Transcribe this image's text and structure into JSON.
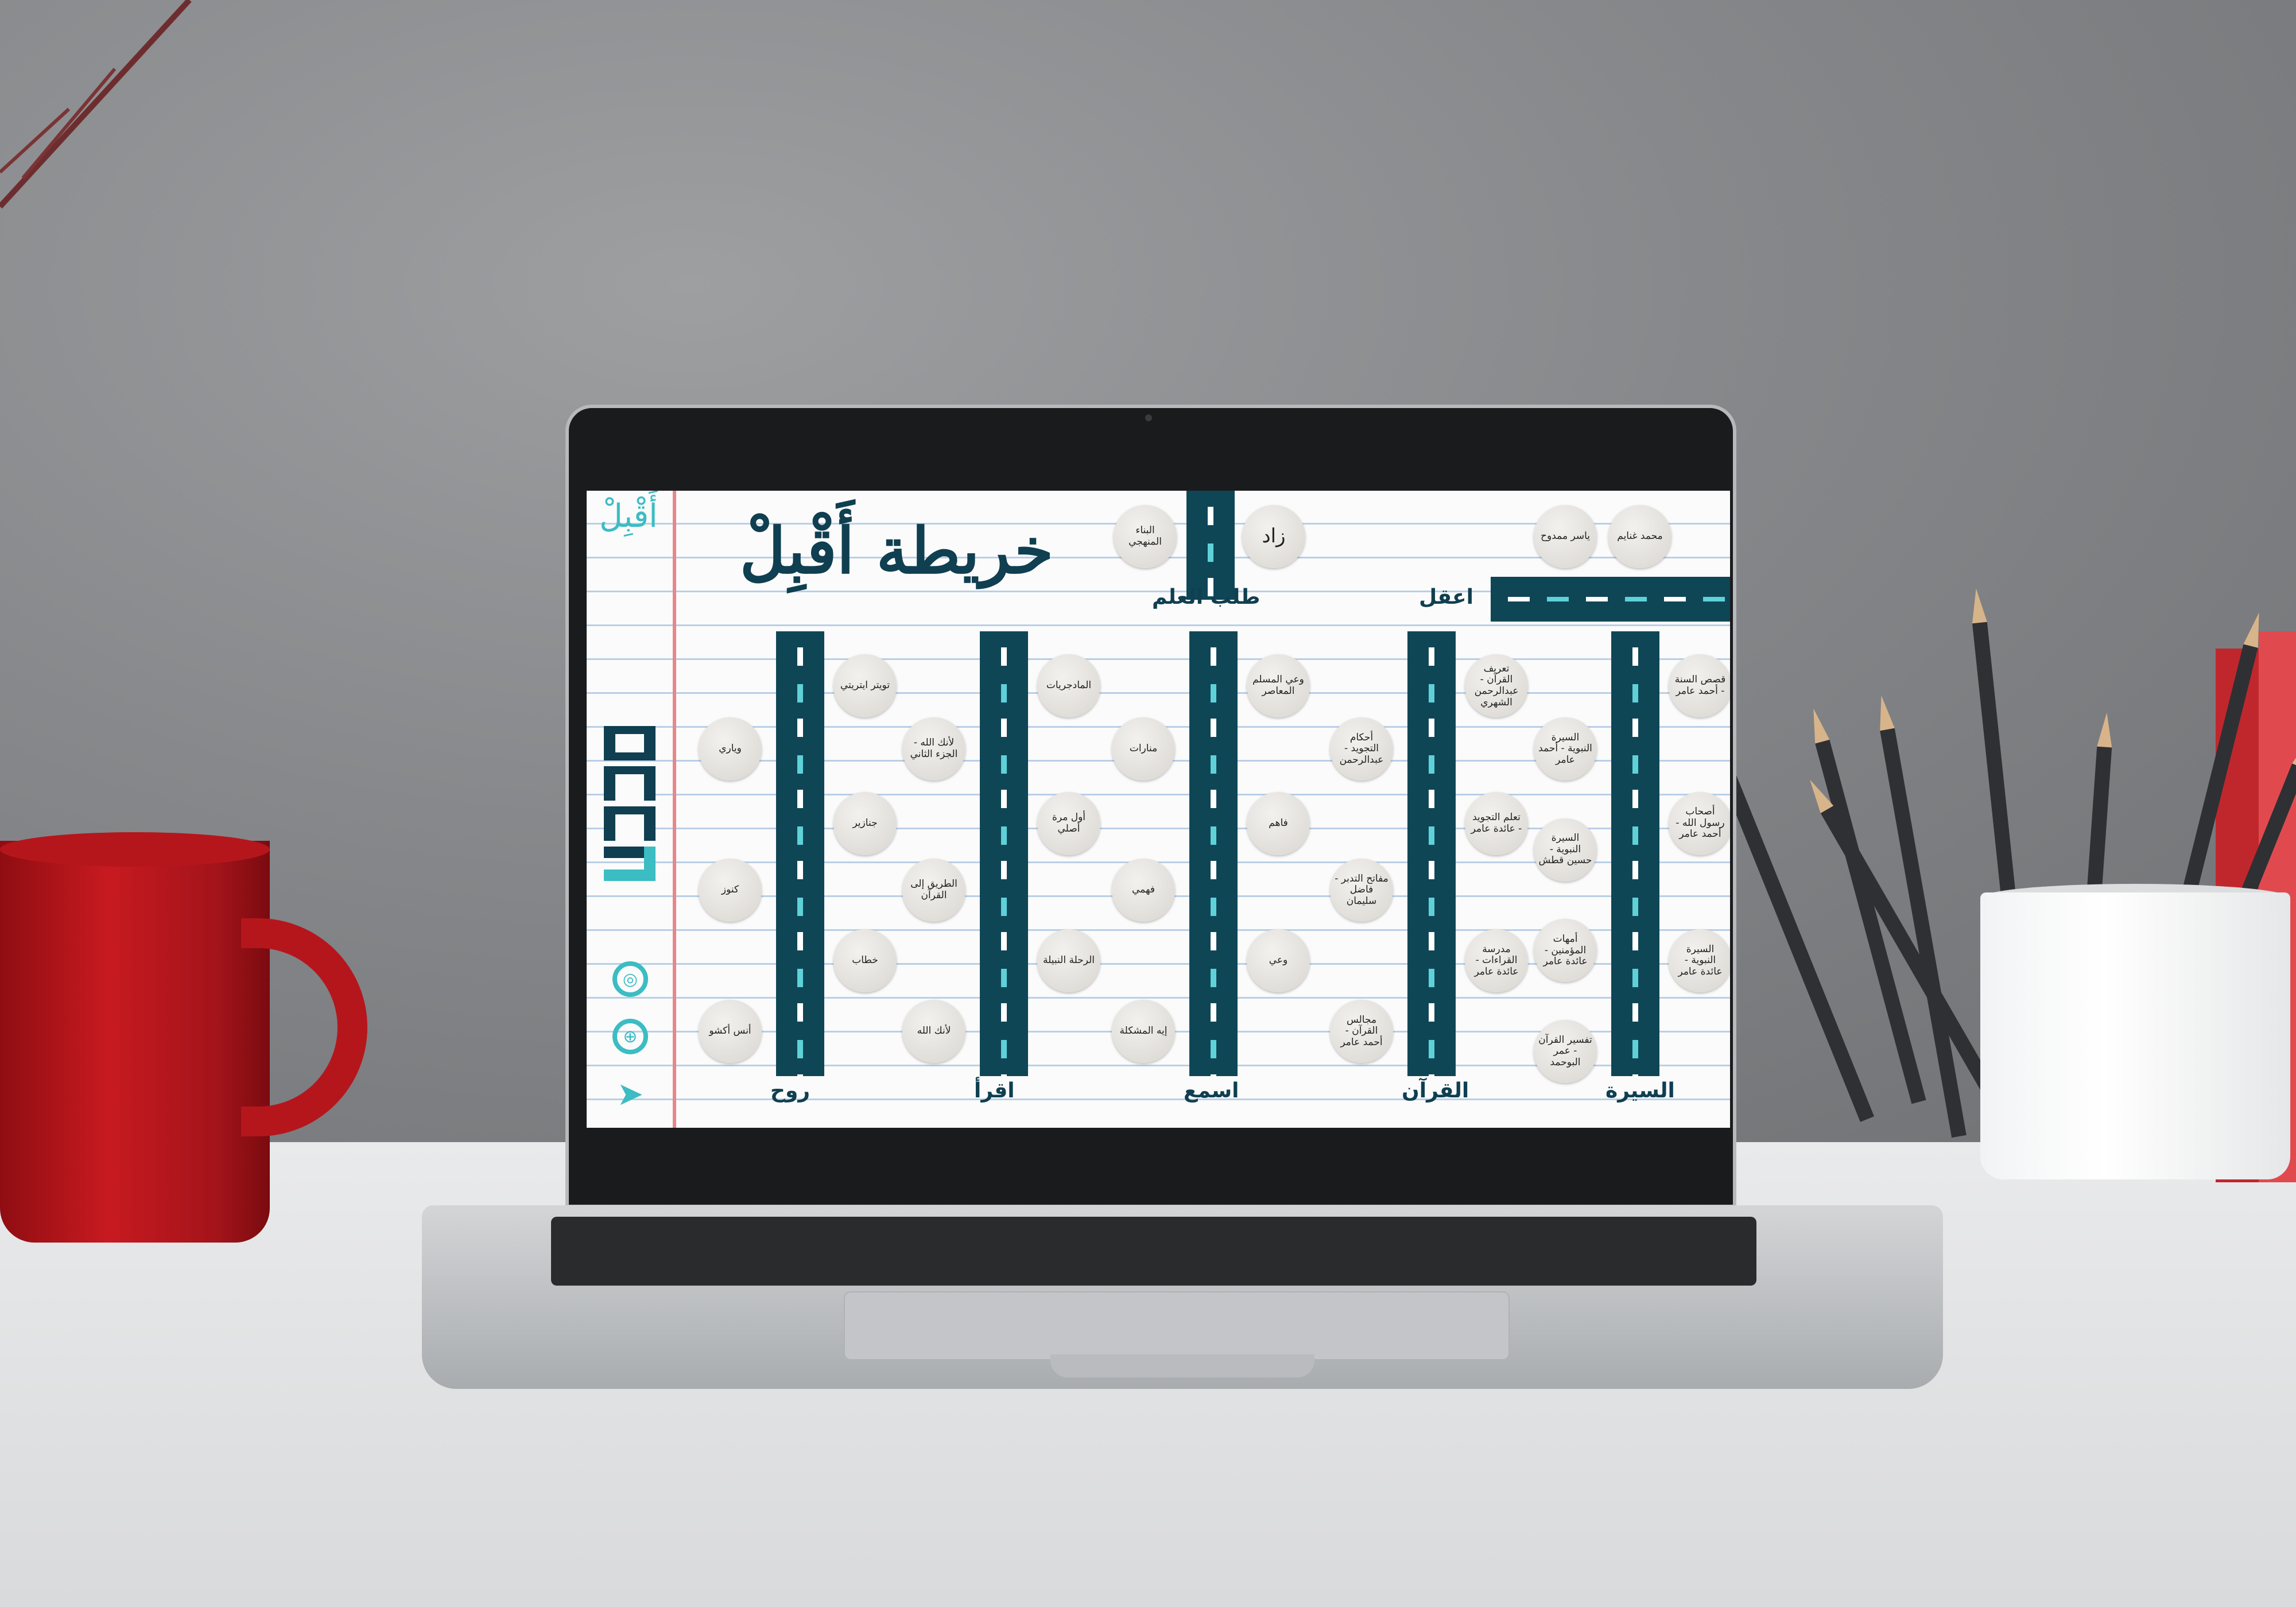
{
  "app": {
    "title": "خريطة أَقْبِلْ",
    "brand_small": "أَقْبِلْ",
    "brand_logo": "DAAJ"
  },
  "top": {
    "nodes": [
      {
        "id": "n-muhammad",
        "text": "محمد غنايم"
      },
      {
        "id": "n-yaser",
        "text": "ياسر ممدوح"
      },
      {
        "id": "n-zad",
        "text": "زاد"
      },
      {
        "id": "n-bina",
        "text": "البناء المنهجي"
      }
    ],
    "labels": {
      "aql": "اعقل",
      "talab": "طلب العلم"
    }
  },
  "columns": [
    {
      "label": "السيرة",
      "left_nodes": [
        {
          "text": "السيرة النبوية - أحمد عامر"
        },
        {
          "text": "السيرة النبوية - حسين قطش"
        },
        {
          "text": "أمهات المؤمنين - عائدة عامر"
        },
        {
          "text": "تفسير القرآن - عمر البوحمد"
        }
      ],
      "right_nodes": [
        {
          "text": "قصص السنة - أحمد عامر"
        },
        {
          "text": "أصحاب رسول الله - أحمد عامر"
        },
        {
          "text": "السيرة النبوية - عائدة عامر"
        }
      ]
    },
    {
      "label": "القرآن",
      "left_nodes": [
        {
          "text": "أحكام التجويد - عبدالرحمن"
        },
        {
          "text": "مفاتح التدبر - فاضل سليمان"
        },
        {
          "text": "مجالس القرآن - أحمد عامر"
        }
      ],
      "right_nodes": [
        {
          "text": "تعريف القرآن - عبدالرحمن الشهري"
        },
        {
          "text": "تعلم التجويد - عائدة عامر"
        },
        {
          "text": "مدرسة القراءات - عائدة عامر"
        }
      ]
    },
    {
      "label": "اسمع",
      "left_nodes": [
        {
          "text": "منارات"
        },
        {
          "text": "فهمي"
        },
        {
          "text": "إيه المشكلة"
        }
      ],
      "right_nodes": [
        {
          "text": "وعي المسلم المعاصر"
        },
        {
          "text": "فاهم"
        },
        {
          "text": "وعي"
        }
      ]
    },
    {
      "label": "اقرأ",
      "left_nodes": [
        {
          "text": "لأنك الله - الجزء الثاني"
        },
        {
          "text": "الطريق إلى القرآن"
        },
        {
          "text": "لأنك الله"
        }
      ],
      "right_nodes": [
        {
          "text": "المادجريات"
        },
        {
          "text": "أول مرة أصلي"
        },
        {
          "text": "الرحلة النبيلة"
        }
      ]
    },
    {
      "label": "روح",
      "left_nodes": [
        {
          "text": "وياري"
        },
        {
          "text": "كنوز"
        },
        {
          "text": "أنس أكشو"
        }
      ],
      "right_nodes": [
        {
          "text": "تويتر ايتريتي"
        },
        {
          "text": "جنازير"
        },
        {
          "text": "خطاب"
        }
      ]
    }
  ],
  "social": [
    {
      "icon": "signal-icon",
      "glyph": "◎"
    },
    {
      "icon": "globe-icon",
      "glyph": "⊕"
    },
    {
      "icon": "telegram-icon",
      "glyph": "➤"
    }
  ],
  "colors": {
    "road": "#0f4656",
    "accent": "#3cbcc3",
    "margin": "#e8868a"
  }
}
